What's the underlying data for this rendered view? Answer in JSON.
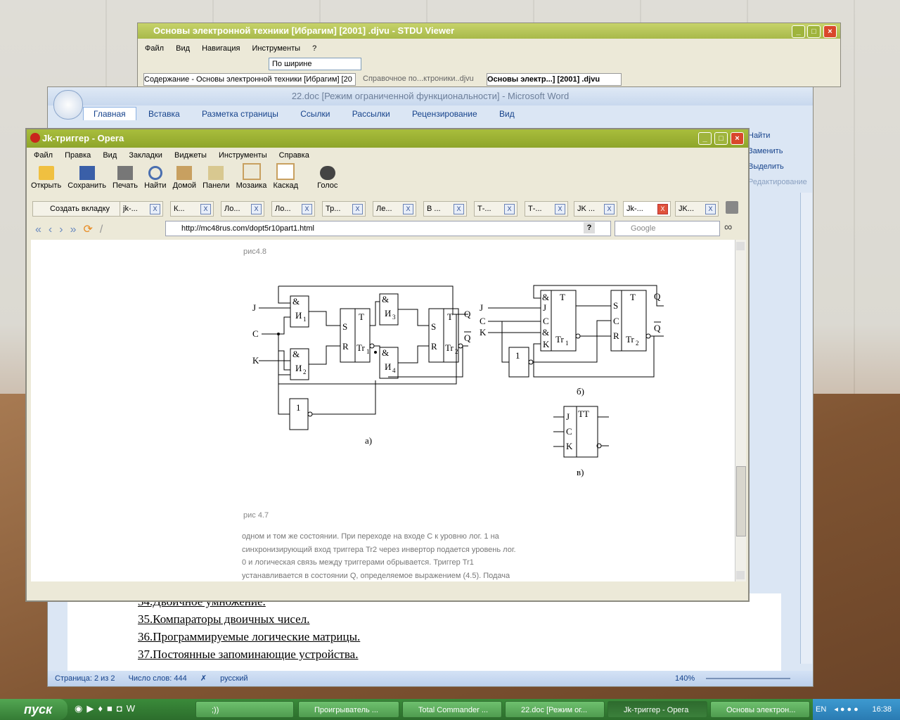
{
  "stdu": {
    "title": "Основы электронной техники [Ибрагим] [2001] .djvu - STDU Viewer",
    "menu": [
      "Файл",
      "Вид",
      "Навигация",
      "Инструменты",
      "?"
    ],
    "zoom_select": "По ширине",
    "tabs": [
      "Содержание - Основы электронной техники [Ибрагим] [20",
      "Справочное по...ктроники..djvu",
      "Основы электр...] [2001] .djvu"
    ]
  },
  "word": {
    "title": "22.doc [Режим ограниченной функциональности] - Microsoft Word",
    "ribbon_tabs": [
      "Главная",
      "Вставка",
      "Разметка страницы",
      "Ссылки",
      "Рассылки",
      "Рецензирование",
      "Вид"
    ],
    "ribbon_right": [
      "Найти",
      "Заменить",
      "Выделить",
      "Редактирование"
    ],
    "doc_lines": [
      "34.Двоичное умножение.",
      "35.Компараторы двоичных чисел.",
      "36.Программируемые логические матрицы.",
      "37.Постоянные запоминающие устройства."
    ],
    "status": {
      "page": "Страница: 2 из 2",
      "words": "Число слов: 444",
      "lang": "русский",
      "zoom": "140%"
    }
  },
  "opera": {
    "title": "Jk-триггер - Opera",
    "menu": [
      "Файл",
      "Правка",
      "Вид",
      "Закладки",
      "Виджеты",
      "Инструменты",
      "Справка"
    ],
    "toolbar": [
      "Открыть",
      "Сохранить",
      "Печать",
      "Найти",
      "Домой",
      "Панели",
      "Мозаика",
      "Каскад",
      "Голос"
    ],
    "new_tab": "Создать вкладку",
    "tabs": [
      "jk-...",
      "К...",
      "Ло...",
      "Ло...",
      "Тр...",
      "Ле...",
      "В ...",
      "Т-...",
      "Т-...",
      "JK ...",
      "Jk-...",
      "JK..."
    ],
    "address": "http://mc48rus.com/dopt5r10part1.html",
    "search_placeholder": "Google",
    "caption_top": "рис4.8",
    "caption_bottom": "рис 4.7",
    "paragraph": [
      "одном и том же состоянии. При переходе на входе C к уровню лог. 1 на",
      "синхронизирующий вход триггера Tr2 через инвертор подается уровень лог.",
      "0 и логическая связь между триггерами обрывается. Триггер Tr1",
      "устанавливается в состоянии Q, определяемое выражением (4.5). Подача"
    ],
    "diagram_labels": {
      "a_J": "J",
      "a_C": "C",
      "a_K": "K",
      "and1": "&",
      "and1_sub": "И",
      "and1_n": "1",
      "and2": "&",
      "and2_sub": "И",
      "and2_n": "2",
      "and3": "&",
      "and3_sub": "И",
      "and3_n": "3",
      "and4": "&",
      "and4_sub": "И",
      "and4_n": "4",
      "tr1_T": "T",
      "tr1_S": "S",
      "tr1_R": "R",
      "tr1_name": "Tr",
      "tr1_n": "1",
      "tr2_T": "T",
      "tr2_S": "S",
      "tr2_R": "R",
      "tr2_name": "Tr",
      "tr2_n": "2",
      "a_Q": "Q",
      "a_Qbar": "Q",
      "inv": "1",
      "cap_a": "а)",
      "b_J": "J",
      "b_C": "C",
      "b_K": "K",
      "b1_amp": "&",
      "b1_J": "J",
      "b1_C": "C",
      "b1_amp2": "&",
      "b1_K": "K",
      "b1_T": "T",
      "b1_name": "Tr",
      "b1_n": "1",
      "b2_S": "S",
      "b2_C": "C",
      "b2_R": "R",
      "b2_T": "T",
      "b2_name": "Tr",
      "b2_n": "2",
      "b_Q": "Q",
      "b_Qbar": "Q",
      "b_inv": "1",
      "cap_b": "б)",
      "c_TT": "TT",
      "c_J": "J",
      "c_C": "C",
      "c_K": "K",
      "cap_c": "в)"
    }
  },
  "taskbar": {
    "start": "пуск",
    "tasks": [
      ";))",
      "Проигрыватель ...",
      "Total Commander ...",
      "22.doc [Режим ог...",
      "Jk-триггер - Opera",
      "Основы электрон..."
    ],
    "lang": "EN",
    "clock": "16:38"
  }
}
